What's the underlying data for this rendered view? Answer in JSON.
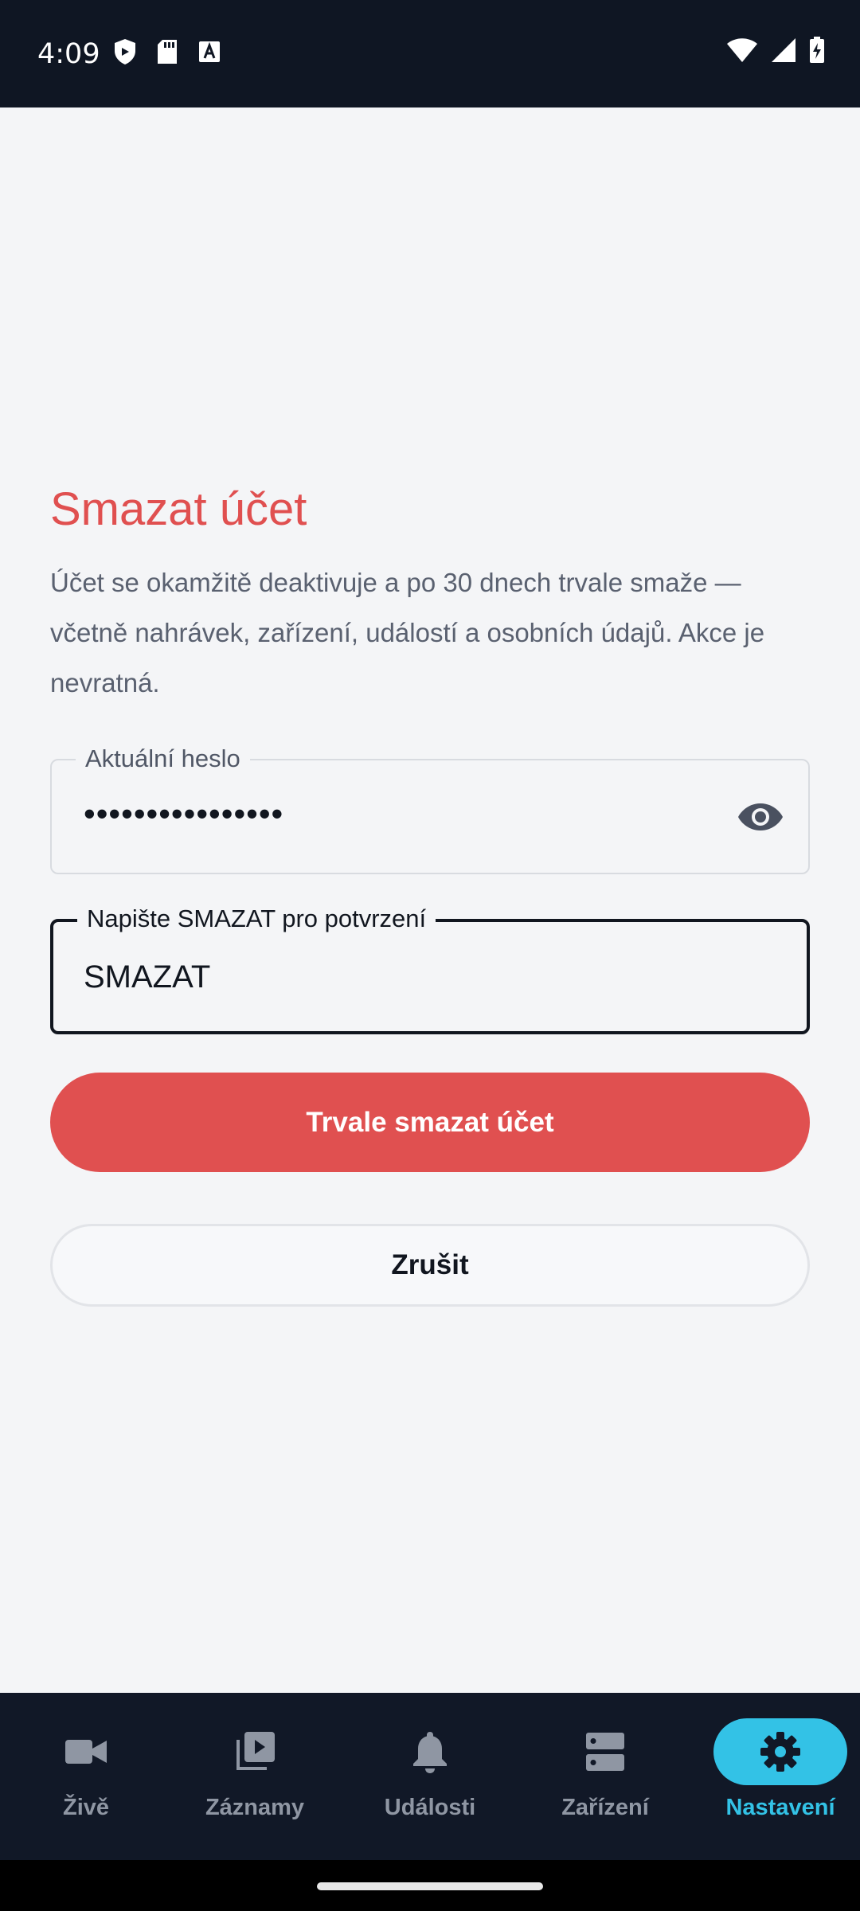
{
  "status_bar": {
    "time": "4:09"
  },
  "page": {
    "title": "Smazat účet",
    "description": "Účet se okamžitě deaktivuje a po 30 dnech trvale smaže — včetně nahrávek, zařízení, událostí a osobních údajů. Akce je nevratná."
  },
  "form": {
    "password": {
      "label": "Aktuální heslo",
      "value": "••••••••••••••••"
    },
    "confirm": {
      "label": "Napište SMAZAT pro potvrzení",
      "value": "SMAZAT"
    },
    "delete_button": "Trvale smazat účet",
    "cancel_button": "Zrušit"
  },
  "bottom_nav": {
    "items": [
      {
        "label": "Živě",
        "icon": "videocam-icon"
      },
      {
        "label": "Záznamy",
        "icon": "video-library-icon"
      },
      {
        "label": "Události",
        "icon": "bell-icon"
      },
      {
        "label": "Zařízení",
        "icon": "storage-icon"
      },
      {
        "label": "Nastavení",
        "icon": "gear-icon",
        "active": true
      }
    ]
  },
  "colors": {
    "danger": "#e05050",
    "accent": "#33c2e6",
    "nav_bg": "#111827",
    "status_bg": "#0f1623"
  }
}
